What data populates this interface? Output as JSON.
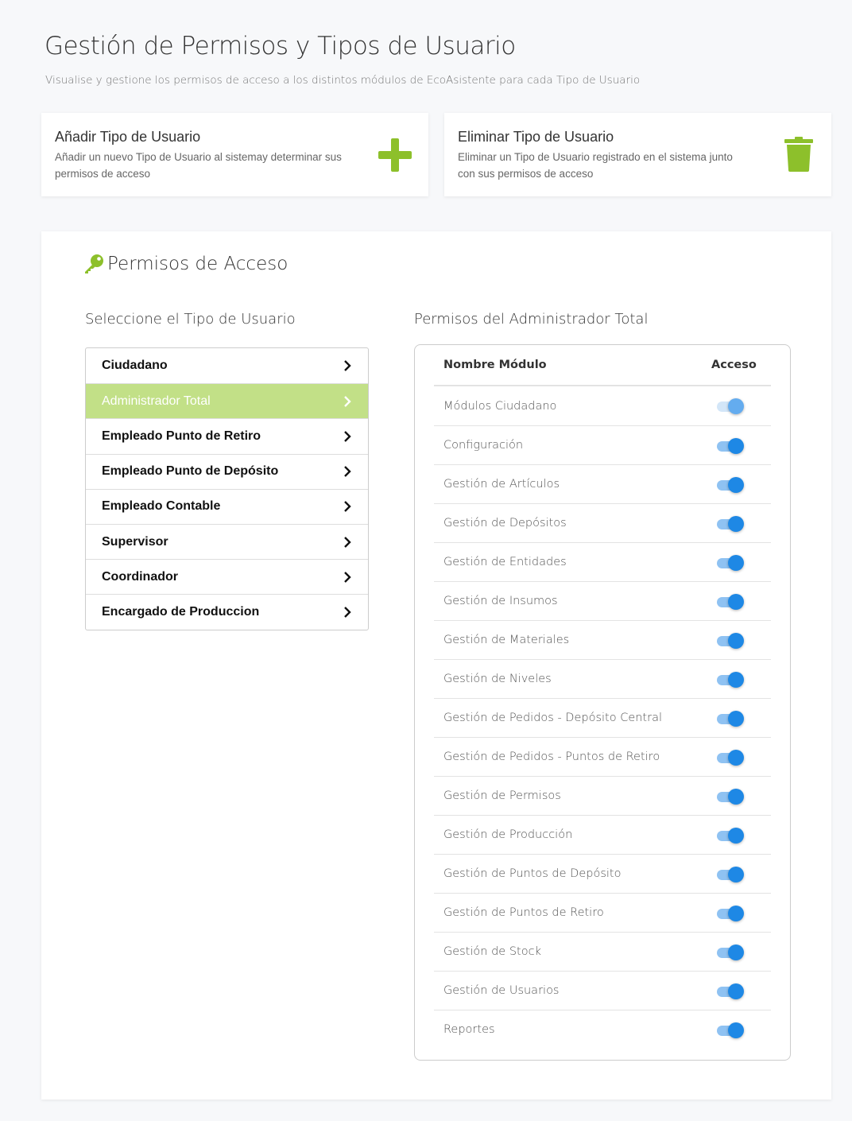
{
  "header": {
    "title": "Gestión de Permisos y Tipos de Usuario",
    "subtitle": "Visualise y gestione los permisos de acceso a los distintos módulos de EcoAsistente para cada Tipo de Usuario"
  },
  "actions": {
    "add": {
      "title": "Añadir Tipo de Usuario",
      "description": "Añadir un nuevo Tipo de Usuario al sistemay determinar sus permisos de acceso",
      "icon": "plus-icon"
    },
    "delete": {
      "title": "Eliminar Tipo de Usuario",
      "description": "Eliminar un Tipo de Usuario registrado en el sistema junto con sus permisos de acceso",
      "icon": "trash-icon"
    }
  },
  "colors": {
    "accent_green": "#8dc02b",
    "active_item_bg": "#c2e087",
    "toggle_blue": "#1e88e5"
  },
  "permissions_panel": {
    "heading": "Permisos de Acceso",
    "heading_icon": "key-icon",
    "user_types_label": "Seleccione el Tipo de Usuario",
    "permissions_label": "Permisos del Administrador Total",
    "user_types": [
      {
        "label": "Ciudadano",
        "active": false
      },
      {
        "label": "Administrador Total",
        "active": true
      },
      {
        "label": "Empleado Punto de Retiro",
        "active": false
      },
      {
        "label": "Empleado Punto de Depósito",
        "active": false
      },
      {
        "label": "Empleado Contable",
        "active": false
      },
      {
        "label": "Supervisor",
        "active": false
      },
      {
        "label": "Coordinador",
        "active": false
      },
      {
        "label": "Encargado de Produccion",
        "active": false
      }
    ],
    "table": {
      "col_module": "Nombre Módulo",
      "col_access": "Acceso",
      "rows": [
        {
          "module": "Módulos Ciudadano",
          "access": true,
          "disabled": true
        },
        {
          "module": "Configuración",
          "access": true
        },
        {
          "module": "Gestión de Artículos",
          "access": true
        },
        {
          "module": "Gestión de Depósitos",
          "access": true
        },
        {
          "module": "Gestión de Entidades",
          "access": true
        },
        {
          "module": "Gestión de Insumos",
          "access": true
        },
        {
          "module": "Gestión de Materiales",
          "access": true
        },
        {
          "module": "Gestión de Niveles",
          "access": true
        },
        {
          "module": "Gestión de Pedidos - Depósito Central",
          "access": true
        },
        {
          "module": "Gestión de Pedidos - Puntos de Retiro",
          "access": true
        },
        {
          "module": "Gestión de Permisos",
          "access": true
        },
        {
          "module": "Gestión de Producción",
          "access": true
        },
        {
          "module": "Gestión de Puntos de Depósito",
          "access": true
        },
        {
          "module": "Gestión de Puntos de Retiro",
          "access": true
        },
        {
          "module": "Gestión de Stock",
          "access": true
        },
        {
          "module": "Gestión de Usuarios",
          "access": true
        },
        {
          "module": "Reportes",
          "access": true
        }
      ]
    }
  }
}
